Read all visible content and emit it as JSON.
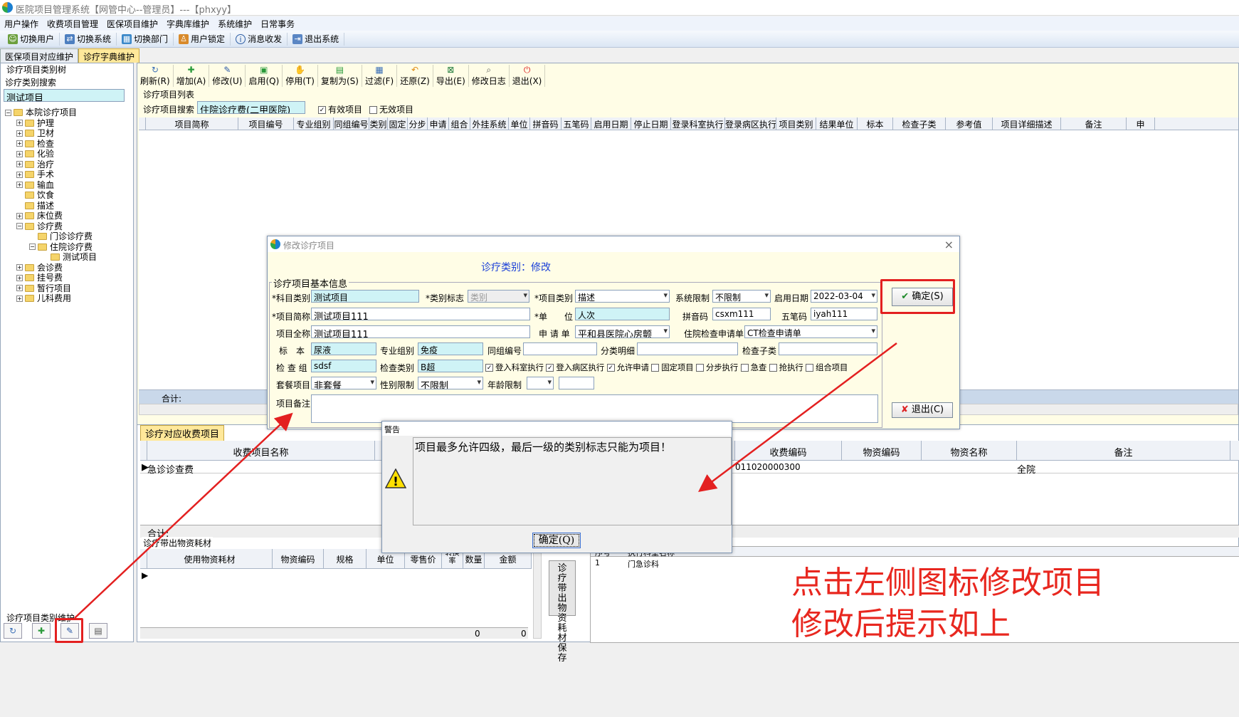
{
  "window": {
    "title": "医院项目管理系统【网管中心--管理员】---【phxyy】"
  },
  "menu": [
    "用户操作",
    "收费项目管理",
    "医保项目维护",
    "字典库维护",
    "系统维护",
    "日常事务"
  ],
  "toolbar": [
    "切换用户",
    "切换系统",
    "切换部门",
    "用户锁定",
    "消息收发",
    "退出系统"
  ],
  "tabs": [
    "医保项目对应维护",
    "诊疗字典维护"
  ],
  "left": {
    "group_title": "诊疗项目类别树",
    "search_label": "诊疗类别搜索",
    "search_value": "测试项目",
    "tree_root": "本院诊疗项目",
    "tree": [
      "护理",
      "卫材",
      "检查",
      "化验",
      "治疗",
      "手术",
      "输血",
      "饮食",
      "描述",
      "床位费",
      "诊疗费",
      "门诊诊疗费",
      "住院诊疗费",
      "测试项目",
      "会诊费",
      "挂号费",
      "暂行项目",
      "儿科费用"
    ],
    "bottom_group": "诊疗项目类别维护"
  },
  "actions": [
    "刷新(R)",
    "增加(A)",
    "修改(U)",
    "启用(Q)",
    "停用(T)",
    "复制为(S)",
    "过滤(F)",
    "还原(Z)",
    "导出(E)",
    "修改日志",
    "退出(X)"
  ],
  "list": {
    "group_title": "诊疗项目列表",
    "search_label": "诊疗项目搜索",
    "search_value": "住院诊疗费(二甲医院)",
    "valid_label": "有效项目",
    "invalid_label": "无效项目",
    "columns": [
      "项目简称",
      "项目编号",
      "专业组别",
      "同组编号",
      "类别",
      "固定",
      "分步",
      "申请",
      "组合",
      "外挂系统",
      "单位",
      "拼音码",
      "五笔码",
      "启用日期",
      "停止日期",
      "登录科室执行",
      "登录病区执行",
      "项目类别",
      "结果单位",
      "标本",
      "检查子类",
      "参考值",
      "项目详细描述",
      "备注",
      "申"
    ],
    "total_label": "合计:"
  },
  "dialog": {
    "title": "修改诊疗项目",
    "heading": "诊疗类别：修改",
    "group": "诊疗项目基本信息",
    "labels": {
      "subject": "*科目类别",
      "flag": "*类别标志",
      "item_type": "*项目类别",
      "sys_limit": "系统限制",
      "start_date": "启用日期",
      "short_name": "*项目简称",
      "unit": "*单　　位",
      "pinyin": "拼音码",
      "wubi": "五笔码",
      "full_name": "项目全称",
      "request": "申 请 单",
      "ward_request": "住院检查申请单",
      "specimen": "标　本",
      "specialty": "专业组别",
      "group_no": "同组编号",
      "class_detail": "分类明细",
      "check_sub": "检查子类",
      "check_group": "检 查 组",
      "check_type": "检查类别",
      "package": "套餐项目",
      "gender": "性别限制",
      "age": "年龄限制",
      "remark": "项目备注"
    },
    "values": {
      "subject": "测试项目",
      "flag": "类别",
      "item_type": "描述",
      "sys_limit": "不限制",
      "start_date": "2022-03-04",
      "short_name": "测试项目111",
      "unit": "人次",
      "pinyin": "csxm111",
      "wubi": "iyah111",
      "full_name": "测试项目111",
      "request": "平和县医院心房颤",
      "ward_request": "CT检查申请单",
      "specimen": "尿液",
      "specialty": "免疫",
      "check_group": "sdsf",
      "check_type": "B超",
      "package": "非套餐",
      "gender": "不限制"
    },
    "checks": [
      "登入科室执行",
      "登入病区执行",
      "允许申请",
      "固定项目",
      "分步执行",
      "急查",
      "抢执行",
      "组合项目"
    ],
    "ok": "确定(S)",
    "exit": "退出(C)"
  },
  "fee": {
    "tab": "诊疗对应收费项目",
    "columns": [
      "收费项目名称",
      "收费编码",
      "物资编码",
      "物资名称",
      "备注"
    ],
    "row": {
      "name": "急诊诊查费",
      "code": "011020000300",
      "remark": "全院"
    },
    "total_label": "合计:"
  },
  "material": {
    "group": "诊疗带出物资耗材",
    "columns": [
      "使用物资耗材",
      "物资编码",
      "规格",
      "单位",
      "零售价",
      "转换率",
      "数量",
      "金额"
    ],
    "zero1": "0",
    "zero2": "0",
    "save_btn": "诊疗带出物资耗材保存",
    "right_cols": [
      "序号",
      "执行科室名称"
    ],
    "right_row": {
      "no": "1",
      "dept": "门急诊科"
    }
  },
  "warning": {
    "title": "警告",
    "message": "项目最多允许四级，最后一级的类别标志只能为项目！",
    "ok": "确定(Q)"
  },
  "annotation": {
    "line1": "点击左侧图标修改项目",
    "line2": "修改后提示如上"
  }
}
